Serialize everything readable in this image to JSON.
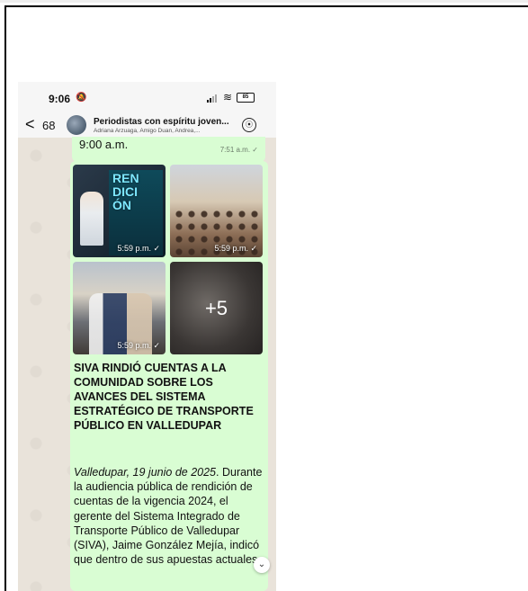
{
  "status_bar": {
    "time": "9:06",
    "silent_icon": "bell-slash-icon",
    "signal_icon": "signal-icon",
    "wifi_icon": "wifi-icon",
    "battery_level": "85"
  },
  "chat_header": {
    "back_count": "68",
    "group_name": "Periodistas con espíritu joven...",
    "participants": "Adriana Arzuaga, Amigo Duan, Andrea,...",
    "call_icon": "voice-call-icon"
  },
  "previous_message": {
    "text": "9:00 a.m.",
    "time": "7:51 a.m. ✓"
  },
  "message": {
    "photos": [
      {
        "time": "5:59 p.m. ✓",
        "poster_text": "REN\nDICI\nÓN"
      },
      {
        "time": "5:59 p.m. ✓"
      },
      {
        "time": "5:59 p.m. ✓"
      },
      {
        "more_count": "+5"
      }
    ],
    "headline": "SIVA RINDIÓ CUENTAS A LA COMUNIDAD SOBRE LOS AVANCES DEL SISTEMA ESTRATÉGICO DE TRANSPORTE PÚBLICO EN VALLEDUPAR",
    "dateline": "Valledupar, 19 junio de 2025",
    "body": ". Durante la audiencia pública de rendición de cuentas de la vigencia 2024, el gerente del Sistema Integrado de Transporte Público de Valledupar (SIVA), Jaime González Mejía, indicó que dentro de sus apuestas actuales"
  },
  "colors": {
    "bubble": "#d9fdd3",
    "chat_background": "#e9e3da",
    "header": "#f6f6f6"
  }
}
